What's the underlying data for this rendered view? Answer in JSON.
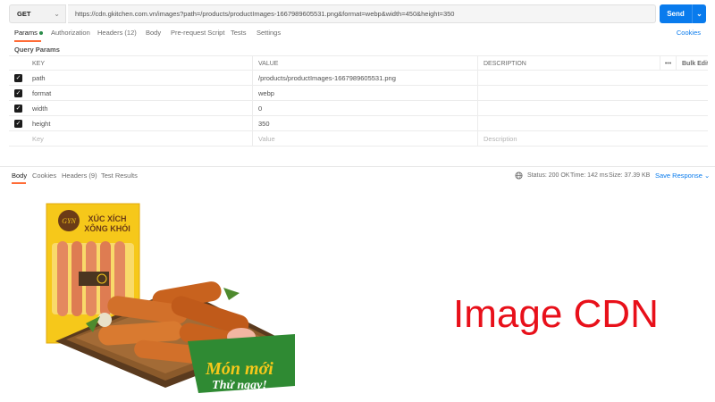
{
  "request": {
    "method": "GET",
    "url": "https://cdn.gkitchen.com.vn/images?path=/products/productImages-1667989605531.png&format=webp&width=450&height=350",
    "send_label": "Send"
  },
  "request_tabs": {
    "params": "Params",
    "authorization": "Authorization",
    "headers": "Headers (12)",
    "body": "Body",
    "prerequest": "Pre-request Script",
    "tests": "Tests",
    "settings": "Settings",
    "cookies": "Cookies"
  },
  "query_params": {
    "title": "Query Params",
    "columns": {
      "key": "KEY",
      "value": "VALUE",
      "description": "DESCRIPTION",
      "more": "•••",
      "bulk_edit": "Bulk Edit"
    },
    "rows": [
      {
        "key": "path",
        "value": "/products/productImages-1667989605531.png",
        "checked": true
      },
      {
        "key": "format",
        "value": "webp",
        "checked": true
      },
      {
        "key": "width",
        "value": "0",
        "checked": true
      },
      {
        "key": "height",
        "value": "350",
        "checked": true
      }
    ],
    "placeholder": {
      "key": "Key",
      "value": "Value",
      "description": "Description"
    }
  },
  "response": {
    "tabs": {
      "body": "Body",
      "cookies": "Cookies",
      "headers": "Headers (9)",
      "test_results": "Test Results"
    },
    "status": "Status: 200 OK",
    "time": "Time: 142 ms",
    "size": "Size: 37.39 KB",
    "save": "Save Response"
  },
  "preview": {
    "overlay_text": "Image CDN",
    "package_brand": "GYN",
    "package_title_1": "XÚC XÍCH",
    "package_title_2": "XÔNG KHÓI",
    "badge_line_1": "Món mới",
    "badge_line_2": "Thử ngay!"
  },
  "colors": {
    "accent_orange": "#ff6c37",
    "send_blue": "#097bed",
    "overlay_red": "#e8101a",
    "package_yellow": "#f6c81a",
    "badge_green": "#2f8a33"
  }
}
